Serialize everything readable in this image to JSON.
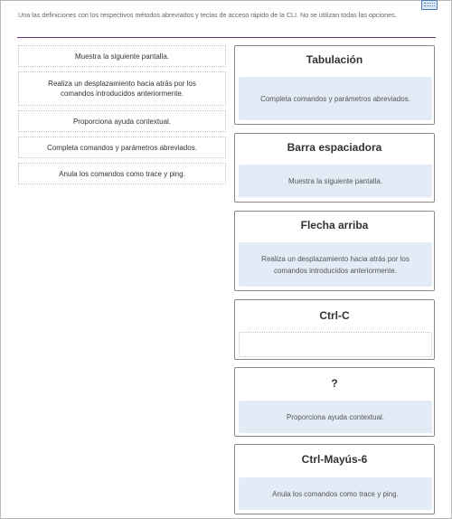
{
  "instructions": "Una las definiciones con los respectivos métodos abreviados y teclas de acceso rápido de la CLI. No se utilizan todas las opciones.",
  "icons": {
    "keyboard": "keyboard-icon"
  },
  "colors": {
    "divider": "#6b2d7a",
    "drop_fill": "#e3ebf6"
  },
  "options": [
    "Muestra la siguiente pantalla.",
    "Realiza un desplazamiento hacia atrás por los comandos introducidos anteriormente.",
    "Proporciona ayuda contextual.",
    "Completa comandos y parámetros abreviados.",
    "Anula los comandos como trace y ping."
  ],
  "targets": [
    {
      "label": "Tabulación",
      "answer": "Completa comandos y parámetros abreviados."
    },
    {
      "label": "Barra espaciadora",
      "answer": "Muestra la siguiente pantalla."
    },
    {
      "label": "Flecha arriba",
      "answer": "Realiza un desplazamiento hacia atrás por los comandos introducidos anteriormente."
    },
    {
      "label": "Ctrl-C",
      "answer": ""
    },
    {
      "label": "?",
      "answer": "Proporciona ayuda contextual."
    },
    {
      "label": "Ctrl-Mayús-6",
      "answer": "Anula los comandos como trace y ping."
    }
  ]
}
